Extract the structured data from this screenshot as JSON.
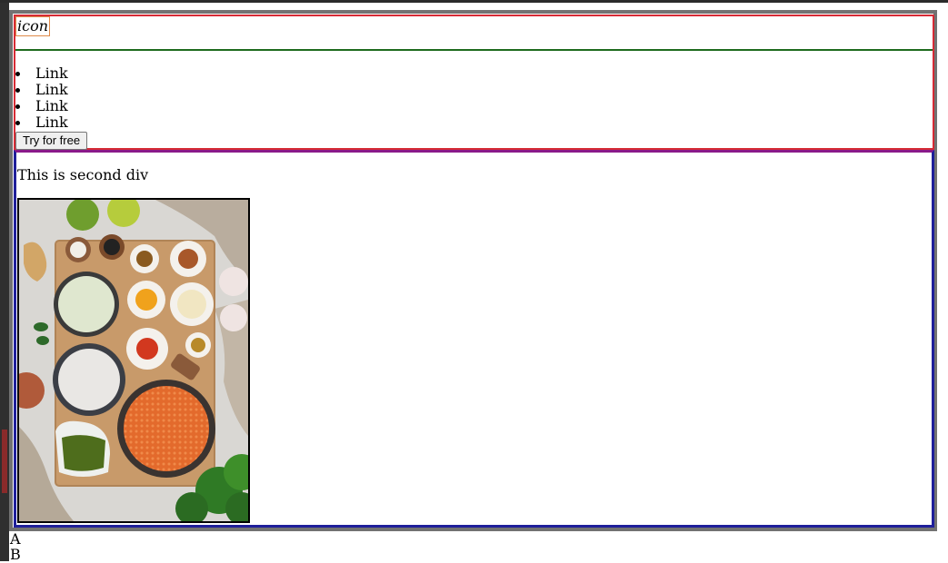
{
  "header": {
    "icon_label": "icon"
  },
  "nav": {
    "links": [
      "Link",
      "Link",
      "Link",
      "Link"
    ]
  },
  "cta": {
    "label": "Try for free"
  },
  "second": {
    "text": "This is second div"
  },
  "below": {
    "items": [
      "A",
      "B"
    ]
  },
  "colors": {
    "first_div_border": "#d62b35",
    "header_divider": "#1e6b1e",
    "second_div_border": "#1f1f9a",
    "container_border": "#727272",
    "icon_border": "#e08a4a"
  },
  "image": {
    "subject": "flat-lay of cooking ingredients: bowls of spices, chopped onion, coconut milk, red lentils, herbs, limes and garlic on a wooden board"
  }
}
